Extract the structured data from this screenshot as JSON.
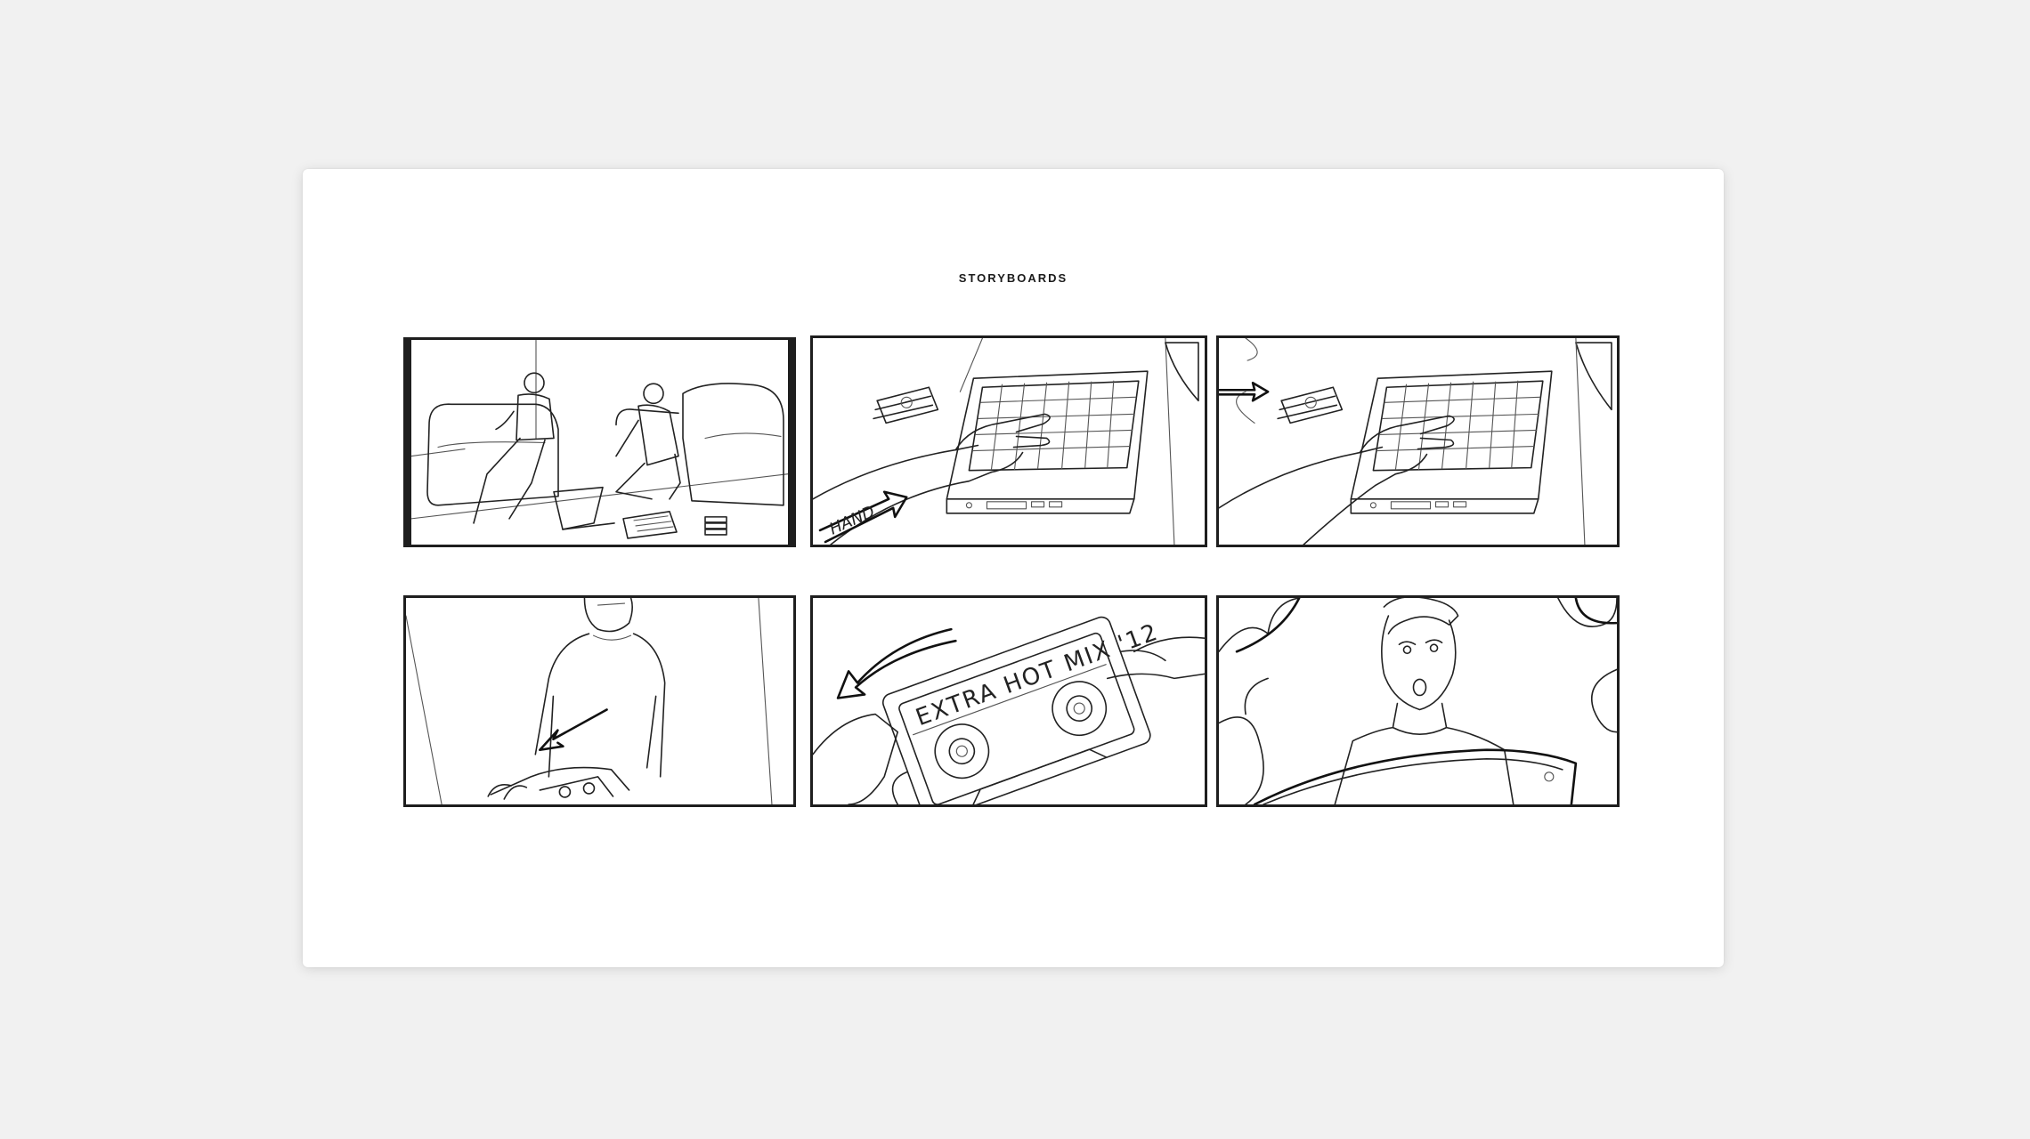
{
  "page": {
    "title": "STORYBOARDS"
  },
  "panels": [
    {
      "id": 1,
      "icon": "living-room-scene-icon"
    },
    {
      "id": 2,
      "icon": "hand-on-pad-icon",
      "label": "HAND"
    },
    {
      "id": 3,
      "icon": "hand-on-pad-icon"
    },
    {
      "id": 4,
      "icon": "person-holding-tape-icon"
    },
    {
      "id": 5,
      "icon": "cassette-tape-icon",
      "label": "EXTRA HOT MIX '12"
    },
    {
      "id": 6,
      "icon": "surprised-face-icon"
    }
  ]
}
